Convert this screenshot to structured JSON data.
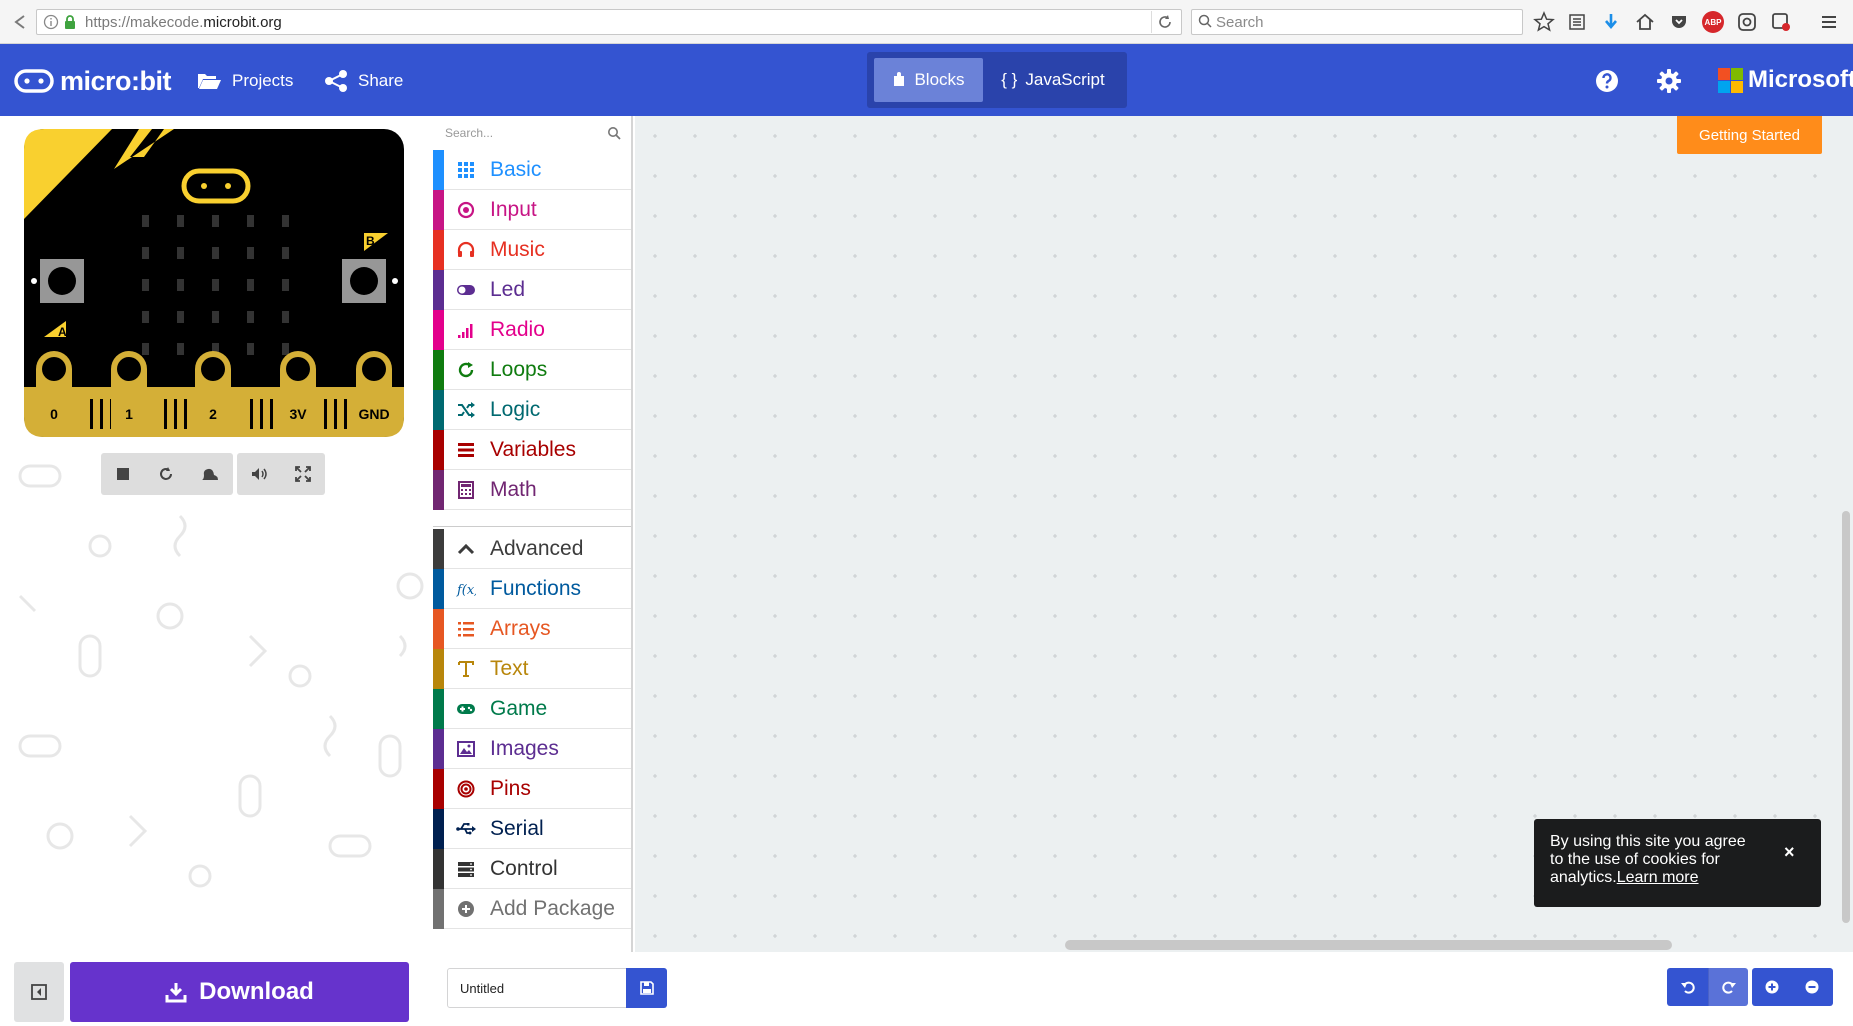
{
  "browser": {
    "url_prefix": "https://makecode.",
    "url_domain": "microbit.org",
    "search_placeholder": "Search",
    "abp_label": "ABP"
  },
  "header": {
    "logo_text": "micro:bit",
    "projects_label": "Projects",
    "share_label": "Share",
    "blocks_label": "Blocks",
    "javascript_label": "JavaScript",
    "microsoft_label": "Microsoft",
    "brand_color": "#3454d1"
  },
  "simulator": {
    "button_a": "A",
    "button_b": "B",
    "pins": [
      "0",
      "1",
      "2",
      "3V",
      "GND"
    ]
  },
  "toolbox": {
    "search_placeholder": "Search...",
    "categories": [
      {
        "label": "Basic",
        "color": "#1e90ff",
        "icon": "grid-icon"
      },
      {
        "label": "Input",
        "color": "#c71585",
        "icon": "target-icon"
      },
      {
        "label": "Music",
        "color": "#e63022",
        "icon": "headphones-icon"
      },
      {
        "label": "Led",
        "color": "#5c2d91",
        "icon": "toggle-icon"
      },
      {
        "label": "Radio",
        "color": "#e3008c",
        "icon": "signal-icon"
      },
      {
        "label": "Loops",
        "color": "#107c10",
        "icon": "refresh-icon"
      },
      {
        "label": "Logic",
        "color": "#006970",
        "icon": "shuffle-icon"
      },
      {
        "label": "Variables",
        "color": "#a80000",
        "icon": "list-icon"
      },
      {
        "label": "Math",
        "color": "#712672",
        "icon": "calculator-icon"
      }
    ],
    "advanced": [
      {
        "label": "Advanced",
        "color": "#3c3c3c",
        "icon": "chevron-up-icon"
      },
      {
        "label": "Functions",
        "color": "#005a9e",
        "icon": "function-icon"
      },
      {
        "label": "Arrays",
        "color": "#e65722",
        "icon": "ordered-list-icon"
      },
      {
        "label": "Text",
        "color": "#b8860b",
        "icon": "text-icon"
      },
      {
        "label": "Game",
        "color": "#007a4b",
        "icon": "gamepad-icon"
      },
      {
        "label": "Images",
        "color": "#5c2d91",
        "icon": "image-icon"
      },
      {
        "label": "Pins",
        "color": "#a80000",
        "icon": "bullseye-icon"
      },
      {
        "label": "Serial",
        "color": "#002050",
        "icon": "usb-icon"
      },
      {
        "label": "Control",
        "color": "#333333",
        "icon": "server-icon"
      },
      {
        "label": "Add Package",
        "color": "#717171",
        "icon": "plus-circle-icon"
      }
    ]
  },
  "workspace": {
    "getting_started_label": "Getting Started",
    "cookie_text": "By using this site you agree to the use of cookies for analytics.",
    "cookie_link": "Learn more",
    "cookie_close": "×"
  },
  "footer": {
    "download_label": "Download",
    "project_name": "Untitled"
  }
}
